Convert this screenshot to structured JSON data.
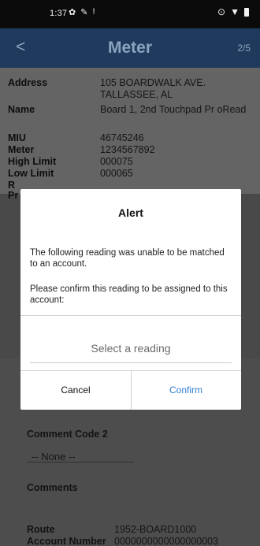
{
  "status_bar": {
    "time": "1:37",
    "left_icons": [
      "gear-icon",
      "wrench-icon",
      "alert-icon"
    ],
    "right_icons": [
      "location-icon",
      "wifi-icon",
      "battery-icon"
    ]
  },
  "app_bar": {
    "title": "Meter",
    "page_count": "2/5",
    "back_glyph": "<"
  },
  "details": [
    {
      "label": "Address",
      "value": "105 BOARDWALK AVE. TALLASSEE, AL"
    },
    {
      "label": "Name",
      "value": "Board 1, 2nd Touchpad  Pr oRead"
    },
    {
      "label": "MIU",
      "value": "46745246"
    },
    {
      "label": "Meter",
      "value": "1234567892"
    },
    {
      "label": "High Limit",
      "value": "000075"
    },
    {
      "label": "Low Limit",
      "value": "000065"
    },
    {
      "label": "R",
      "value": ""
    },
    {
      "label": "Pr",
      "value": ""
    }
  ],
  "dialog": {
    "title": "Alert",
    "message_1": "The following reading was unable to be matched to an account.",
    "message_2": "Please confirm this reading to be assigned to this account:",
    "select_placeholder": "Select a reading",
    "cancel_label": "Cancel",
    "confirm_label": "Confirm"
  },
  "bottom": {
    "comment_code_2_label": "Comment Code 2",
    "comment_code_2_value": "-- None --",
    "comments_label": "Comments",
    "route_label": "Route",
    "route_value": "1952-BOARD1000",
    "account_number_label": "Account Number",
    "account_number_value": "0000000000000000003"
  },
  "colors": {
    "header_bg": "#1f3a5c",
    "confirm_blue": "#2f7fd0"
  }
}
